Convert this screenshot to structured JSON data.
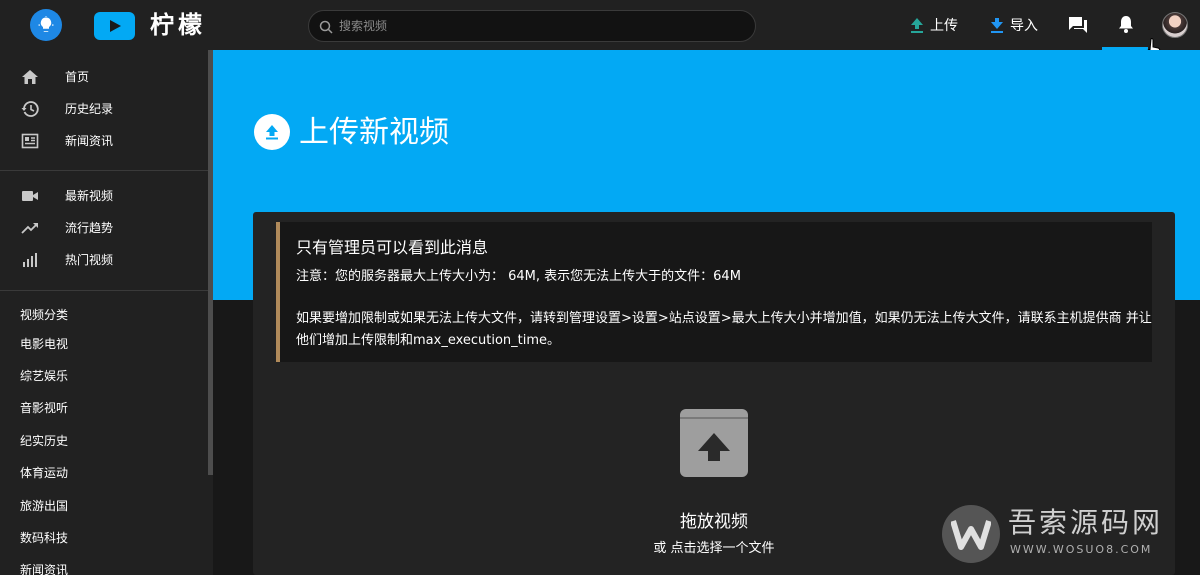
{
  "header": {
    "logo_text": "柠檬",
    "search_placeholder": "搜索视频",
    "upload_label": "上传",
    "import_label": "导入"
  },
  "sidebar": {
    "main_items": [
      {
        "label": "首页",
        "icon": "home-icon"
      },
      {
        "label": "历史纪录",
        "icon": "history-icon"
      },
      {
        "label": "新闻资讯",
        "icon": "news-icon"
      }
    ],
    "video_items": [
      {
        "label": "最新视频",
        "icon": "videocam-icon"
      },
      {
        "label": "流行趋势",
        "icon": "trending-icon"
      },
      {
        "label": "热门视频",
        "icon": "bar-chart-icon"
      }
    ],
    "category_title": "视频分类",
    "categories": [
      "电影电视",
      "综艺娱乐",
      "音影视听",
      "纪实历史",
      "体育运动",
      "旅游出国",
      "数码科技",
      "新闻资讯"
    ]
  },
  "page": {
    "title": "上传新视频"
  },
  "notice": {
    "title": "只有管理员可以看到此消息",
    "line1": "注意：您的服务器最大上传大小为： 64M, 表示您无法上传大于的文件：64M",
    "line2": "如果要增加限制或如果无法上传大文件，请转到管理设置>设置>站点设置>最大上传大小并增加值，如果仍无法上传大文件，请联系主机提供商 并让他们增加上传限制和max_execution_time。"
  },
  "dropzone": {
    "title": "拖放视频",
    "subtitle": "或 点击选择一个文件"
  },
  "watermark": {
    "title": "吾索源码网",
    "subtitle": "WWW.WOSUO8.COM"
  },
  "colors": {
    "accent": "#03a9f4",
    "header_bg": "#212121",
    "notice_border": "#b08a5a"
  }
}
